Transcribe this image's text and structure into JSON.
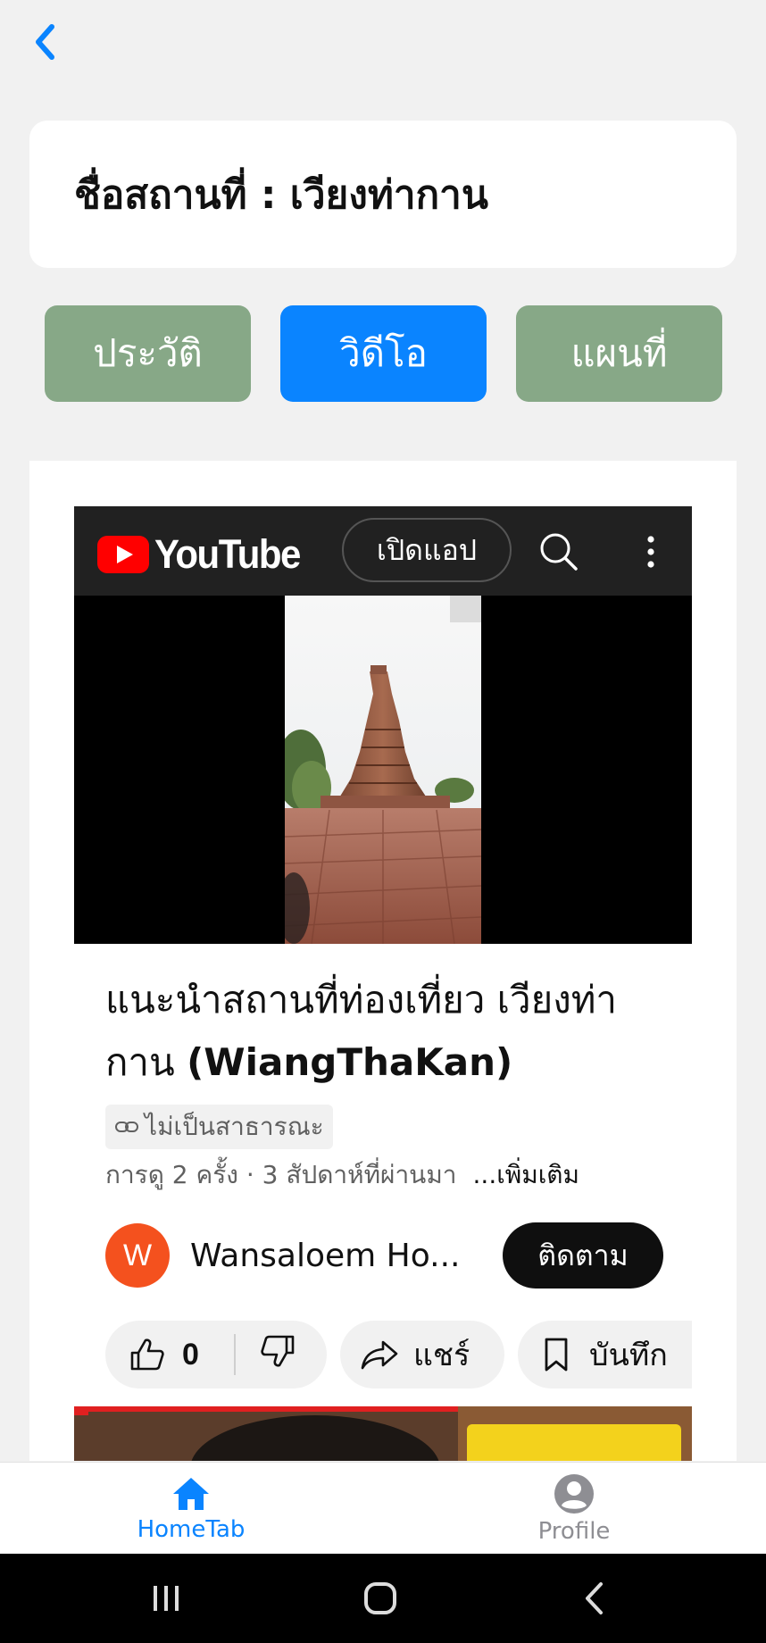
{
  "nav": {
    "back_icon": "chevron-left-icon"
  },
  "header": {
    "title": "ชื่อสถานที่ : เวียงท่ากาน"
  },
  "tabs": [
    {
      "label": "ประวัติ",
      "active": false
    },
    {
      "label": "วิดีโอ",
      "active": true
    },
    {
      "label": "แผนที่",
      "active": false
    }
  ],
  "colors": {
    "accent": "#0a84ff",
    "tab_inactive": "#87a887",
    "youtube_red": "#ff0000"
  },
  "youtube": {
    "logo_text": "YouTube",
    "open_app_label": "เปิดแอป",
    "video_title_thai": "แนะนำสถานที่ท่องเที่ยว เวียงท่ากาน",
    "video_title_en": "(WiangThaKan)",
    "privacy_label": "ไม่เป็นสาธารณะ",
    "meta": "การดู 2 ครั้ง · 3 สัปดาห์ที่ผ่านมา",
    "more_label": "...เพิ่มเติม",
    "channel_initial": "W",
    "channel_name": "Wansaloem Ho...",
    "subscribe_label": "ติดตาม",
    "like_count": "0",
    "share_label": "แชร์",
    "save_label": "บันทึก"
  },
  "bottom_tabs": [
    {
      "label": "HomeTab",
      "icon": "home-icon",
      "active": true
    },
    {
      "label": "Profile",
      "icon": "profile-icon",
      "active": false
    }
  ]
}
